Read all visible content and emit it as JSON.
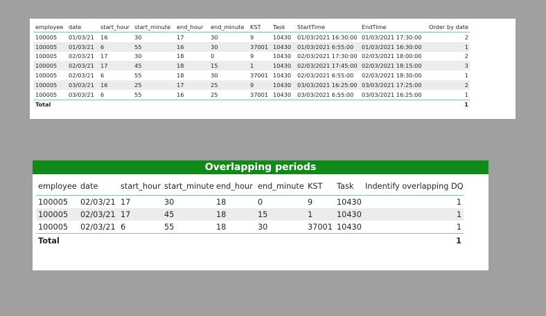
{
  "table1": {
    "columns": [
      "employee",
      "date",
      "start_hour",
      "start_minute",
      "end_hour",
      "end_minute",
      "KST",
      "Task",
      "StartTime",
      "EndTime",
      "Order by date"
    ],
    "rows": [
      [
        "100005",
        "01/03/21",
        "16",
        "30",
        "17",
        "30",
        "9",
        "10430",
        "01/03/2021 16:30:00",
        "01/03/2021 17:30:00",
        "2"
      ],
      [
        "100005",
        "01/03/21",
        "6",
        "55",
        "16",
        "30",
        "37001",
        "10430",
        "01/03/2021 6:55:00",
        "01/03/2021 16:30:00",
        "1"
      ],
      [
        "100005",
        "02/03/21",
        "17",
        "30",
        "18",
        "0",
        "9",
        "10430",
        "02/03/2021 17:30:00",
        "02/03/2021 18:00:00",
        "2"
      ],
      [
        "100005",
        "02/03/21",
        "17",
        "45",
        "18",
        "15",
        "1",
        "10430",
        "02/03/2021 17:45:00",
        "02/03/2021 18:15:00",
        "3"
      ],
      [
        "100005",
        "02/03/21",
        "6",
        "55",
        "18",
        "30",
        "37001",
        "10430",
        "02/03/2021 6:55:00",
        "02/03/2021 18:30:00",
        "1"
      ],
      [
        "100005",
        "03/03/21",
        "16",
        "25",
        "17",
        "25",
        "9",
        "10430",
        "03/03/2021 16:25:00",
        "03/03/2021 17:25:00",
        "2"
      ],
      [
        "100005",
        "03/03/21",
        "6",
        "55",
        "16",
        "25",
        "37001",
        "10430",
        "03/03/2021 6:55:00",
        "03/03/2021 16:25:00",
        "1"
      ]
    ],
    "total_label": "Total",
    "total_value": "1"
  },
  "table2": {
    "title": "Overlapping periods",
    "columns": [
      "employee",
      "date",
      "start_hour",
      "start_minute",
      "end_hour",
      "end_minute",
      "KST",
      "Task",
      "Indentify overlapping DQ"
    ],
    "rows": [
      [
        "100005",
        "02/03/21",
        "17",
        "30",
        "18",
        "0",
        "9",
        "10430",
        "1"
      ],
      [
        "100005",
        "02/03/21",
        "17",
        "45",
        "18",
        "15",
        "1",
        "10430",
        "1"
      ],
      [
        "100005",
        "02/03/21",
        "6",
        "55",
        "18",
        "30",
        "37001",
        "10430",
        "1"
      ]
    ],
    "total_label": "Total",
    "total_value": "1"
  },
  "colors": {
    "background": "#a0a0a0",
    "title_bar": "#118a1a",
    "row_stripe": "#ececec",
    "divider": "#8bb9c2"
  }
}
